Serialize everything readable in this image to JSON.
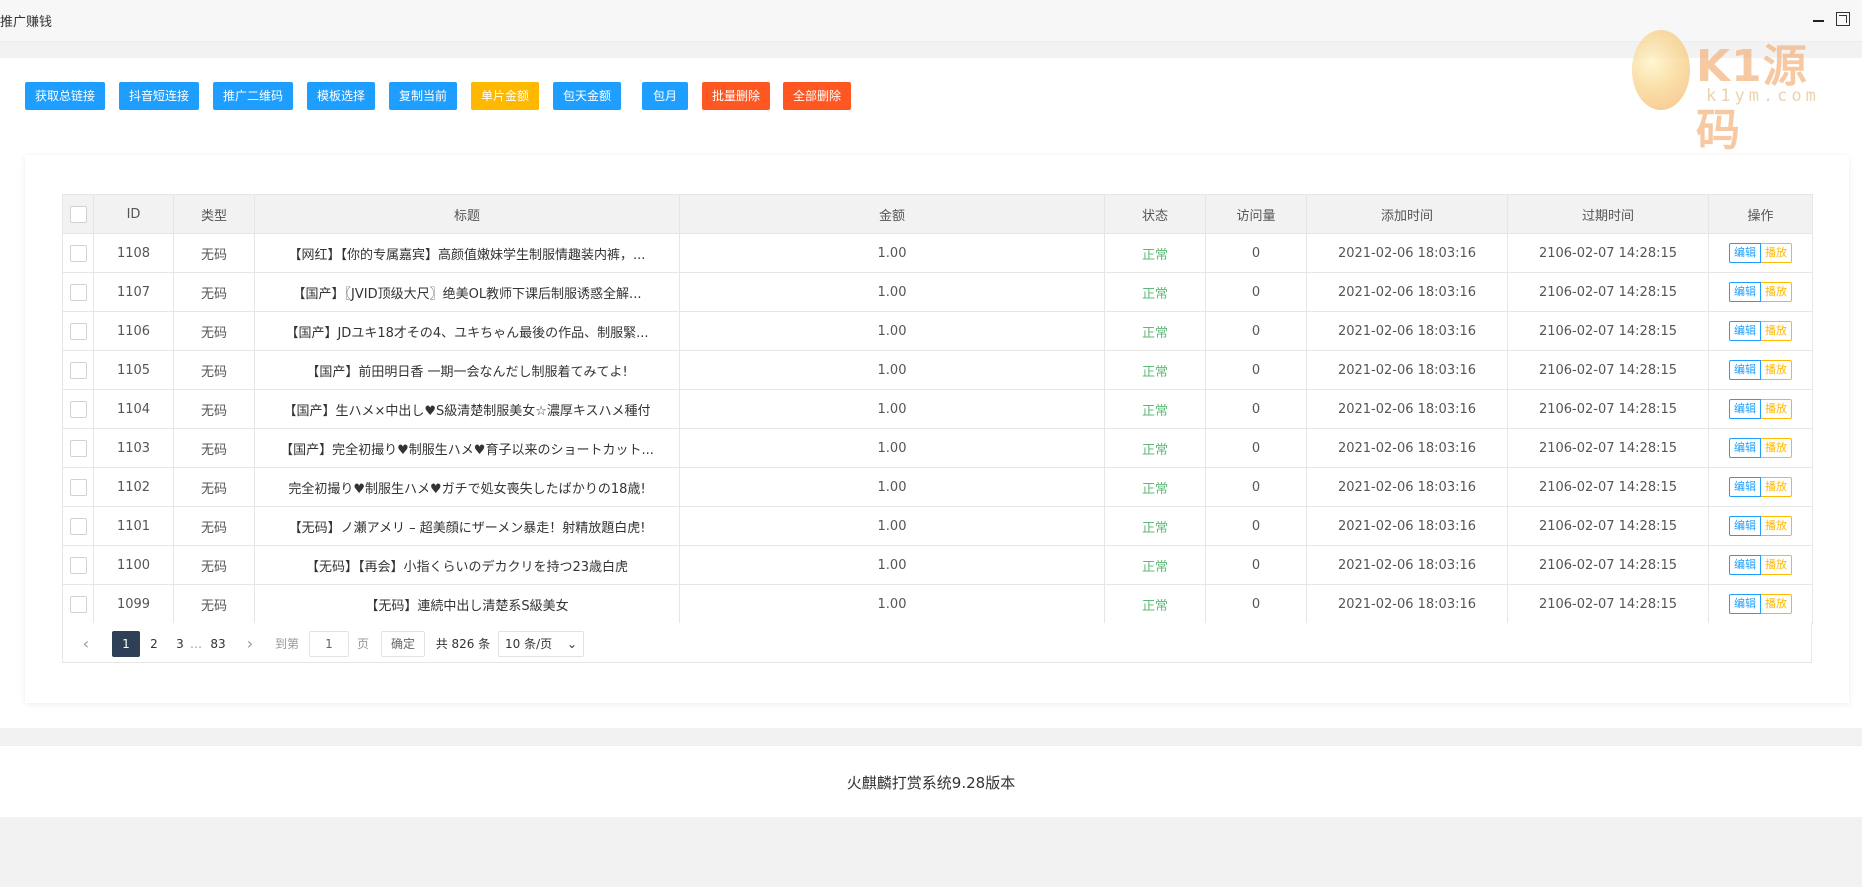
{
  "window": {
    "title": "推广赚钱"
  },
  "watermark": {
    "brand": "K1源码",
    "sub": "k1ym.com"
  },
  "toolbar": {
    "buttons": [
      {
        "label": "获取总链接",
        "color": "#1e9fff"
      },
      {
        "label": "抖音短连接",
        "color": "#1e9fff"
      },
      {
        "label": "推广二维码",
        "color": "#1e9fff"
      },
      {
        "label": "模板选择",
        "color": "#1e9fff"
      },
      {
        "label": "复制当前",
        "color": "#1e9fff"
      },
      {
        "label": "单片金额",
        "color": "#ffb800"
      },
      {
        "label": "包天金额",
        "color": "#1e9fff"
      },
      {
        "label": "包月",
        "color": "#1e9fff"
      },
      {
        "label": "批量删除",
        "color": "#ff5722"
      },
      {
        "label": "全部删除",
        "color": "#ff5722"
      }
    ]
  },
  "table": {
    "headers": {
      "id": "ID",
      "type": "类型",
      "title": "标题",
      "amount": "金额",
      "status": "状态",
      "visits": "访问量",
      "added": "添加时间",
      "expires": "过期时间",
      "ops": "操作"
    },
    "edit_label": "编辑",
    "play_label": "播放",
    "rows": [
      {
        "id": "1108",
        "type": "无码",
        "title": "【网红】【你的专属嘉宾】高颜值嫩妹学生制服情趣装内裤，...",
        "amount": "1.00",
        "status": "正常",
        "visits": "0",
        "added": "2021-02-06 18:03:16",
        "expires": "2106-02-07 14:28:15"
      },
      {
        "id": "1107",
        "type": "无码",
        "title": "【国产】〖JVID顶级大尺〗绝美OL教师下课后制服诱惑全解...",
        "amount": "1.00",
        "status": "正常",
        "visits": "0",
        "added": "2021-02-06 18:03:16",
        "expires": "2106-02-07 14:28:15"
      },
      {
        "id": "1106",
        "type": "无码",
        "title": "【国产】JDユキ18才その4、ユキちゃん最後の作品、制服緊...",
        "amount": "1.00",
        "status": "正常",
        "visits": "0",
        "added": "2021-02-06 18:03:16",
        "expires": "2106-02-07 14:28:15"
      },
      {
        "id": "1105",
        "type": "无码",
        "title": "【国产】前田明日香 一期一会なんだし制服着てみてよ!",
        "amount": "1.00",
        "status": "正常",
        "visits": "0",
        "added": "2021-02-06 18:03:16",
        "expires": "2106-02-07 14:28:15"
      },
      {
        "id": "1104",
        "type": "无码",
        "title": "【国产】生ハメ×中出し♥S級清楚制服美女☆濃厚キスハメ種付",
        "amount": "1.00",
        "status": "正常",
        "visits": "0",
        "added": "2021-02-06 18:03:16",
        "expires": "2106-02-07 14:28:15"
      },
      {
        "id": "1103",
        "type": "无码",
        "title": "【国产】完全初撮り♥制服生ハメ♥育子以来のショートカット...",
        "amount": "1.00",
        "status": "正常",
        "visits": "0",
        "added": "2021-02-06 18:03:16",
        "expires": "2106-02-07 14:28:15"
      },
      {
        "id": "1102",
        "type": "无码",
        "title": "完全初撮り♥制服生ハメ♥ガチで処女喪失したばかりの18歳!",
        "amount": "1.00",
        "status": "正常",
        "visits": "0",
        "added": "2021-02-06 18:03:16",
        "expires": "2106-02-07 14:28:15"
      },
      {
        "id": "1101",
        "type": "无码",
        "title": "【无码】ノ瀬アメリ – 超美顔にザーメン暴走！射精放題白虎!",
        "amount": "1.00",
        "status": "正常",
        "visits": "0",
        "added": "2021-02-06 18:03:16",
        "expires": "2106-02-07 14:28:15"
      },
      {
        "id": "1100",
        "type": "无码",
        "title": "【无码】【再会】小指くらいのデカクリを持つ23歳白虎",
        "amount": "1.00",
        "status": "正常",
        "visits": "0",
        "added": "2021-02-06 18:03:16",
        "expires": "2106-02-07 14:28:15"
      },
      {
        "id": "1099",
        "type": "无码",
        "title": "【无码】連続中出し清楚系S級美女",
        "amount": "1.00",
        "status": "正常",
        "visits": "0",
        "added": "2021-02-06 18:03:16",
        "expires": "2106-02-07 14:28:15"
      }
    ]
  },
  "pagination": {
    "prev": "‹",
    "next": "›",
    "pages": [
      "1",
      "2",
      "3"
    ],
    "ellipsis": "…",
    "last": "83",
    "goto_label": "到第",
    "goto_value": "1",
    "page_suffix": "页",
    "confirm": "确定",
    "total": "共 826 条",
    "per_page": "10 条/页"
  },
  "footer": {
    "text": "火麒麟打赏系统9.28版本"
  }
}
